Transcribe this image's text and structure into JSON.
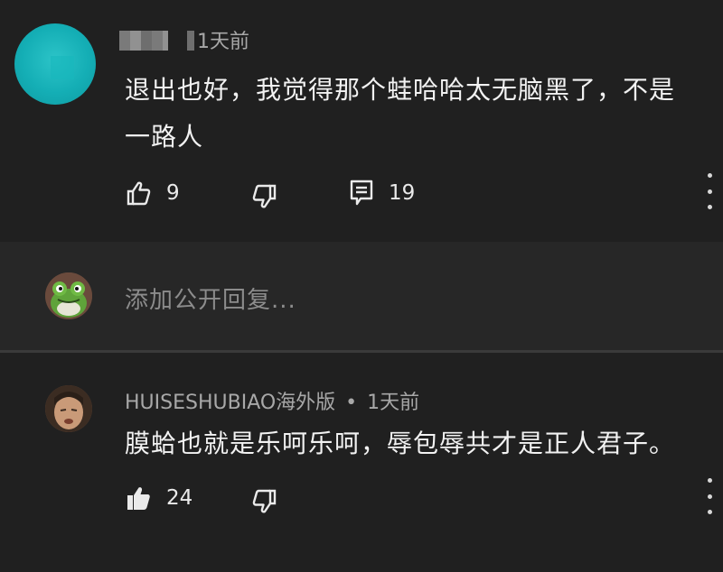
{
  "main_comment": {
    "author": "",
    "time": "1天前",
    "text_line1": "退出也好，我觉得那个蛙哈哈太无脑黑了，不是",
    "text_line2": "一路人",
    "likes": "9",
    "replies": "19",
    "avatar_color": "#14aeb5"
  },
  "reply_box": {
    "placeholder": "添加公开回复..."
  },
  "reply_comment": {
    "author": "HUISESHUBIAO海外版",
    "separator": "•",
    "time": "1天前",
    "text": "膜蛤也就是乐呵乐呵，辱包辱共才是正人君子。",
    "likes": "24"
  },
  "icons": [
    "thumb-up-icon",
    "thumb-down-icon",
    "reply-icon",
    "more-vert-icon",
    "thumb-up-filled-icon"
  ],
  "theme": {
    "background": "#1f1f1f",
    "reply_area": "#272727",
    "text": "#f2f2f2",
    "secondary_text": "#a8a8a8"
  }
}
